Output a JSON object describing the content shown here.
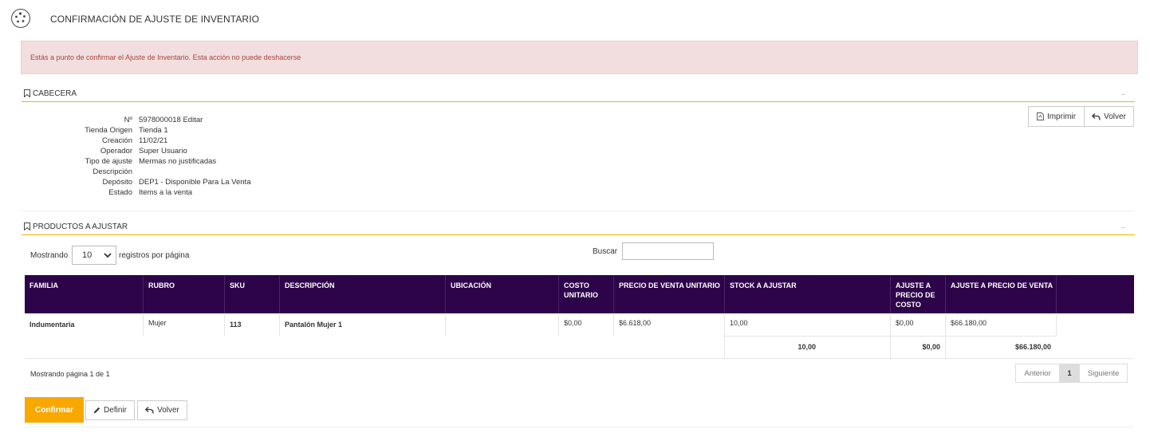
{
  "header": {
    "title": "CONFIRMACIÓN DE AJUSTE DE INVENTARIO"
  },
  "alert": {
    "text": "Estás a punto de confirmar el Ajuste de Inventario. Esta acción no puede deshacerse"
  },
  "cabecera": {
    "title": "CABECERA",
    "collapse": "–",
    "print_label": "Imprimir",
    "back_label": "Volver",
    "fields": [
      {
        "label": "Nº",
        "value": "5978000018 Editar"
      },
      {
        "label": "Tienda Origen",
        "value": "Tienda 1"
      },
      {
        "label": "Creación",
        "value": "11/02/21"
      },
      {
        "label": "Operador",
        "value": "Super Usuario"
      },
      {
        "label": "Tipo de ajuste",
        "value": "Mermas no justificadas"
      },
      {
        "label": "Descripción",
        "value": ""
      },
      {
        "label": "Depósito",
        "value": "DEP1 - Disponible Para La Venta"
      },
      {
        "label": "Estado",
        "value": "Items a la venta"
      }
    ]
  },
  "productos": {
    "title": "PRODUCTOS A AJUSTAR",
    "collapse": "–",
    "length_prefix": "Mostrando",
    "length_value": "10",
    "length_suffix": "registros por página",
    "search_label": "Buscar",
    "search_value": "",
    "columns": [
      "FAMILIA",
      "RUBRO",
      "SKU",
      "DESCRIPCIÓN",
      "UBICACIÓN",
      "COSTO UNITARIO",
      "PRECIO DE VENTA UNITARIO",
      "STOCK A AJUSTAR",
      "AJUSTE A PRECIO DE COSTO",
      "AJUSTE A PRECIO DE VENTA"
    ],
    "rows": [
      {
        "familia": "Indumentaria",
        "rubro": "Mujer",
        "sku": "113",
        "descripcion": "Pantalón Mujer 1",
        "ubicacion": "",
        "costo": "$0,00",
        "precio": "$6.618,00",
        "stock": "10,00",
        "aj_costo": "$0,00",
        "aj_venta": "$66.180,00"
      }
    ],
    "totals": {
      "stock": "10,00",
      "aj_costo": "$0,00",
      "aj_venta": "$66.180,00"
    },
    "page_info": "Mostrando página 1 de 1",
    "pager": {
      "prev": "Anterior",
      "current": "1",
      "next": "Siguiente"
    }
  },
  "actions": {
    "confirm": "Confirmar",
    "define": "Definir",
    "back": "Volver"
  },
  "colors": {
    "accent": "#f9a800",
    "table_header": "#2d0449",
    "alert_bg": "#f2dedf",
    "alert_text": "#a94442"
  }
}
